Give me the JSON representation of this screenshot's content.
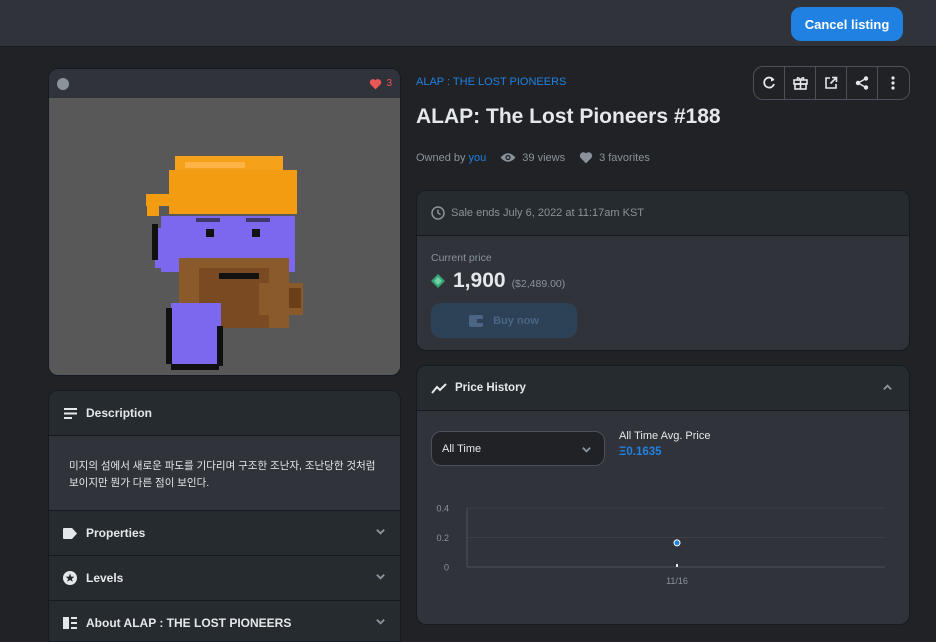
{
  "header": {
    "cancel_label": "Cancel listing"
  },
  "item": {
    "favorites_count": "3",
    "collection_name": "ALAP : THE LOST PIONEERS",
    "title": "ALAP: The Lost Pioneers #188",
    "owned_by_label": "Owned by",
    "owner": "you",
    "views": "39 views",
    "favorites": "3 favorites"
  },
  "description": {
    "heading": "Description",
    "text": "미지의 섬에서 새로운 파도를 기다리며 구조한 조난자, 조난당한 것처럼 보이지만 뭔가 다른 점이 보인다."
  },
  "accordions": [
    {
      "label": "Properties"
    },
    {
      "label": "Levels"
    },
    {
      "label": "About ALAP : THE LOST PIONEERS"
    }
  ],
  "sale": {
    "ends": "Sale ends July 6, 2022 at 11:17am KST",
    "current_price_label": "Current price",
    "price": "1,900",
    "price_usd": "($2,489.00)",
    "buy_label": "Buy now"
  },
  "price_history": {
    "heading": "Price History",
    "range": "All Time",
    "avg_label": "All Time Avg. Price",
    "avg_value": "Ξ0.1635"
  },
  "chart_data": {
    "type": "scatter",
    "x_categories": [
      "11/16"
    ],
    "y_ticks": [
      "0.4",
      "0.2",
      "0"
    ],
    "ylim": [
      0,
      0.4
    ],
    "points": [
      {
        "x": "11/16",
        "y": 0.1635
      }
    ],
    "grid": true
  },
  "colors": {
    "accent": "#2081e2",
    "favorite": "#eb5757",
    "background": "#202225",
    "card": "#303339"
  }
}
